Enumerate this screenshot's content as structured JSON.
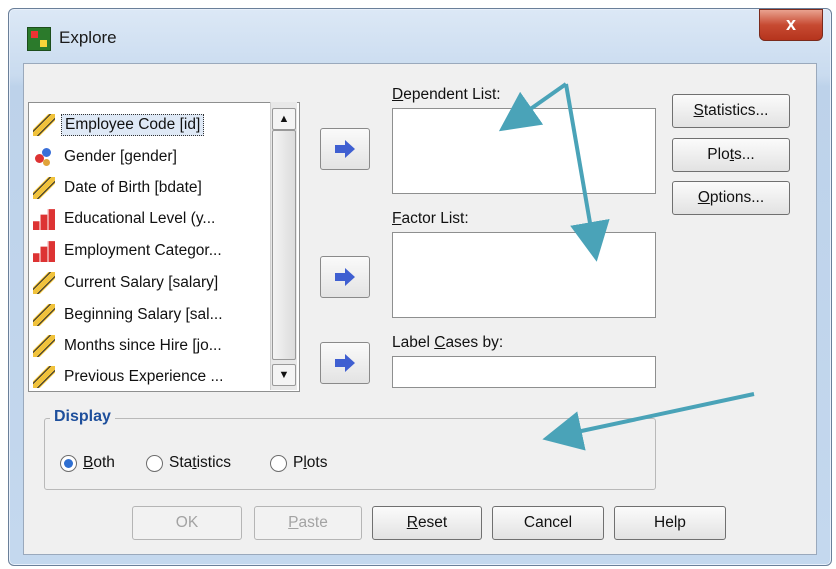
{
  "window": {
    "title": "Explore",
    "close_label": "x"
  },
  "variables": [
    {
      "label": "Employee Code [id]",
      "icon": "scale-ruler-icon",
      "selected": true
    },
    {
      "label": "Gender [gender]",
      "icon": "nominal-icon"
    },
    {
      "label": "Date of Birth [bdate]",
      "icon": "scale-ruler-icon"
    },
    {
      "label": "Educational Level (y...",
      "icon": "ordinal-bars-icon"
    },
    {
      "label": "Employment Categor...",
      "icon": "ordinal-bars-icon"
    },
    {
      "label": "Current Salary [salary]",
      "icon": "scale-ruler-icon"
    },
    {
      "label": "Beginning Salary [sal...",
      "icon": "scale-ruler-icon"
    },
    {
      "label": "Months since Hire [jo...",
      "icon": "scale-ruler-icon"
    },
    {
      "label": "Previous Experience ...",
      "icon": "scale-ruler-icon"
    }
  ],
  "fields": {
    "dependent_list": {
      "mnemonic": "D",
      "rest": "ependent List:"
    },
    "factor_list": {
      "mnemonic": "F",
      "rest": "actor List:"
    },
    "label_cases": {
      "before": "Label ",
      "mnemonic": "C",
      "rest": "ases by:"
    }
  },
  "side_buttons": {
    "statistics": {
      "mnemonic": "S",
      "rest": "tatistics..."
    },
    "plots": {
      "before": "Plo",
      "mnemonic": "t",
      "rest": "s..."
    },
    "options": {
      "mnemonic": "O",
      "rest": "ptions..."
    }
  },
  "display": {
    "title": "Display",
    "options": [
      {
        "mnemonic": "B",
        "rest": "oth",
        "checked": true
      },
      {
        "before": "Sta",
        "mnemonic": "t",
        "rest": "istics",
        "checked": false
      },
      {
        "before": "P",
        "mnemonic": "l",
        "rest": "ots",
        "checked": false
      }
    ]
  },
  "bottom_buttons": {
    "ok": "OK",
    "paste": {
      "mnemonic": "P",
      "rest": "aste"
    },
    "reset": {
      "mnemonic": "R",
      "rest": "eset"
    },
    "cancel": "Cancel",
    "help": "Help"
  },
  "colors": {
    "annotation_arrow": "#4aa3b8",
    "move_arrow": "#3f5fd1",
    "display_title": "#1e4f9c"
  }
}
